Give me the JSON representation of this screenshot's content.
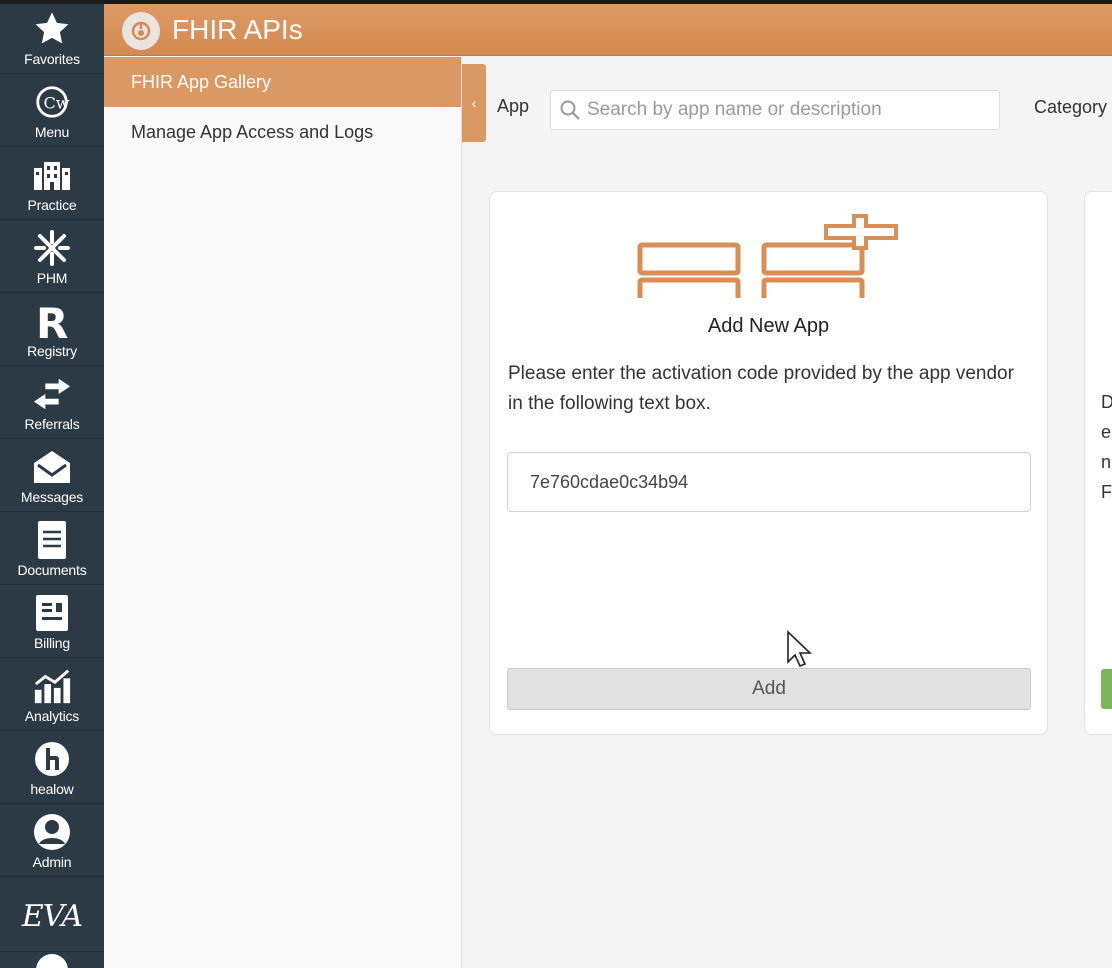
{
  "rail": {
    "items": [
      {
        "label": "Favorites",
        "icon": "star-icon"
      },
      {
        "label": "Menu",
        "icon": "cw-logo-icon"
      },
      {
        "label": "Practice",
        "icon": "building-icon"
      },
      {
        "label": "PHM",
        "icon": "phm-icon"
      },
      {
        "label": "Registry",
        "icon": "registry-r-icon"
      },
      {
        "label": "Referrals",
        "icon": "swap-arrows-icon"
      },
      {
        "label": "Messages",
        "icon": "envelope-icon"
      },
      {
        "label": "Documents",
        "icon": "document-icon"
      },
      {
        "label": "Billing",
        "icon": "billing-icon"
      },
      {
        "label": "Analytics",
        "icon": "analytics-icon"
      },
      {
        "label": "healow",
        "icon": "healow-icon"
      },
      {
        "label": "Admin",
        "icon": "user-icon"
      }
    ],
    "eva_logo": "EVA"
  },
  "header": {
    "title": "FHIR APIs",
    "color": "#d99058"
  },
  "subnav": {
    "items": [
      {
        "label": "FHIR App Gallery",
        "active": true
      },
      {
        "label": "Manage App Access and Logs",
        "active": false
      }
    ]
  },
  "filters": {
    "app_label": "App",
    "search_placeholder": "Search by app name or description",
    "category_label": "Category"
  },
  "card": {
    "title": "Add New App",
    "description": "Please enter the activation code provided by the app vendor in the following text box.",
    "code_value": "7e760cdae0c34b94",
    "add_label": "Add"
  },
  "card2": {
    "fragments": [
      "D",
      "e",
      "n",
      "F"
    ]
  },
  "colors": {
    "accent": "#dc9863",
    "rail_bg": "#2b3a45",
    "success": "#7cb65d"
  }
}
